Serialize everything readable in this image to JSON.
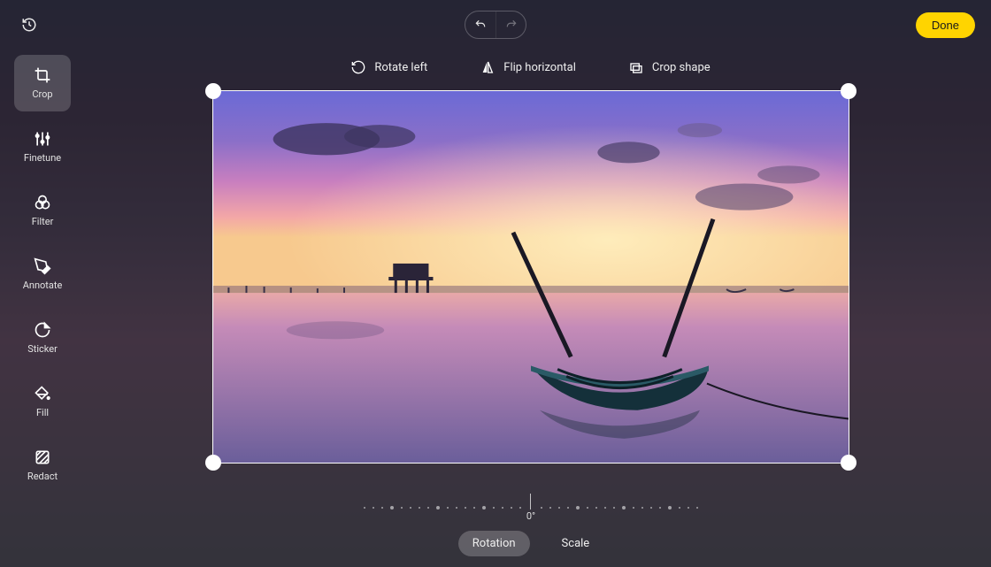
{
  "header": {
    "done_label": "Done"
  },
  "sidebar": {
    "items": [
      {
        "label": "Crop",
        "icon": "crop-icon",
        "active": true
      },
      {
        "label": "Finetune",
        "icon": "sliders-icon",
        "active": false
      },
      {
        "label": "Filter",
        "icon": "three-circles-icon",
        "active": false
      },
      {
        "label": "Annotate",
        "icon": "pen-icon",
        "active": false
      },
      {
        "label": "Sticker",
        "icon": "sticker-icon",
        "active": false
      },
      {
        "label": "Fill",
        "icon": "bucket-icon",
        "active": false
      },
      {
        "label": "Redact",
        "icon": "hatch-icon",
        "active": false
      }
    ]
  },
  "actions": {
    "rotate_left": "Rotate left",
    "flip_horizontal": "Flip horizontal",
    "crop_shape": "Crop shape"
  },
  "rotation": {
    "angle_label": "0°",
    "angle_value": 0
  },
  "bottom_tabs": {
    "rotation": "Rotation",
    "scale": "Scale",
    "active": "rotation"
  }
}
